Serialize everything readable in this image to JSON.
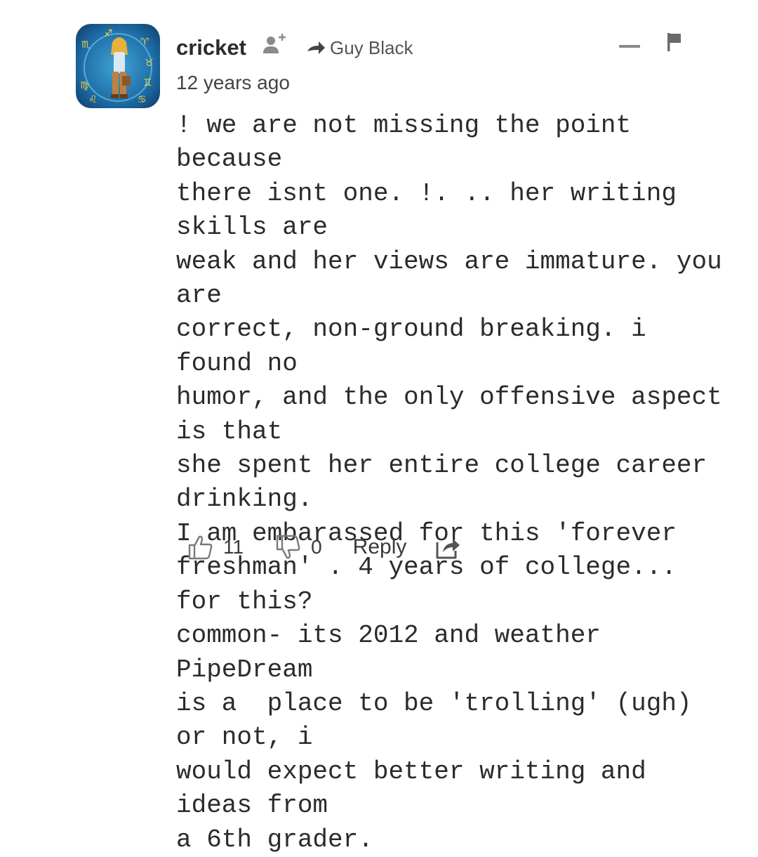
{
  "comment": {
    "author": "cricket",
    "reply_to": "Guy Black",
    "timestamp": "12 years ago",
    "text": "! we are not missing the point because\nthere isnt one. !. .. her writing skills are\nweak and her views are immature. you are\ncorrect, non-ground breaking. i found no\nhumor, and the only offensive aspect is that\nshe spent her entire college career drinking.\nI am embarassed for this 'forever\nfreshman' . 4 years of college... for this?\ncommon- its 2012 and weather PipeDream\nis a  place to be 'trolling' (ugh) or not, i\nwould expect better writing and ideas from\na 6th grader.",
    "upvotes": "11",
    "downvotes": "0",
    "reply_label": "Reply"
  },
  "icons": {
    "avatar": "zodiac-avatar",
    "follow": "add-user-icon",
    "reply_to": "reply-arrow-icon",
    "collapse": "minus-icon",
    "flag": "flag-icon",
    "upvote": "thumbs-up-icon",
    "downvote": "thumbs-down-icon",
    "share": "share-icon"
  },
  "colors": {
    "text": "#2b2b2b",
    "muted": "#555555",
    "icon": "#7a7a7a"
  }
}
